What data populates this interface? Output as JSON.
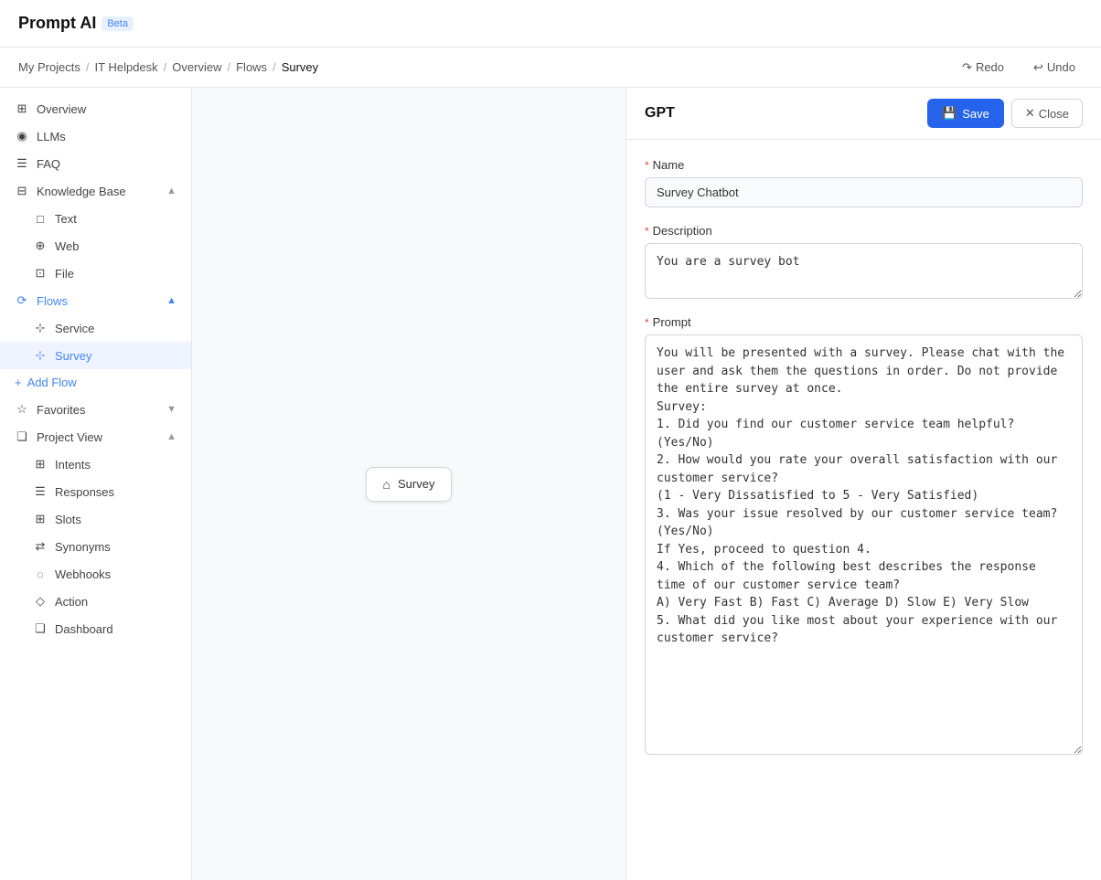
{
  "app": {
    "title": "Prompt AI",
    "beta_label": "Beta"
  },
  "breadcrumb": {
    "items": [
      "My Projects",
      "IT Helpdesk",
      "Overview",
      "Flows",
      "Survey"
    ],
    "redo_label": "Redo",
    "undo_label": "Undo"
  },
  "sidebar": {
    "overview_label": "Overview",
    "llms_label": "LLMs",
    "faq_label": "FAQ",
    "knowledge_base_label": "Knowledge Base",
    "text_label": "Text",
    "web_label": "Web",
    "file_label": "File",
    "flows_label": "Flows",
    "service_label": "Service",
    "survey_label": "Survey",
    "add_flow_label": "Add Flow",
    "favorites_label": "Favorites",
    "project_view_label": "Project View",
    "intents_label": "Intents",
    "responses_label": "Responses",
    "slots_label": "Slots",
    "synonyms_label": "Synonyms",
    "webhooks_label": "Webhooks",
    "action_label": "Action",
    "dashboard_label": "Dashboard"
  },
  "canvas": {
    "node_label": "Survey"
  },
  "panel": {
    "title": "GPT",
    "save_label": "Save",
    "close_label": "Close",
    "name_label": "Name",
    "name_value": "Survey Chatbot",
    "description_label": "Description",
    "description_value": "You are a survey bot",
    "prompt_label": "Prompt",
    "prompt_value": "You will be presented with a survey. Please chat with the user and ask them the questions in order. Do not provide the entire survey at once.\nSurvey:\n1. Did you find our customer service team helpful? (Yes/No)\n2. How would you rate your overall satisfaction with our customer service?\n(1 - Very Dissatisfied to 5 - Very Satisfied)\n3. Was your issue resolved by our customer service team? (Yes/No)\nIf Yes, proceed to question 4.\n4. Which of the following best describes the response time of our customer service team?\nA) Very Fast B) Fast C) Average D) Slow E) Very Slow\n5. What did you like most about your experience with our customer service?"
  }
}
